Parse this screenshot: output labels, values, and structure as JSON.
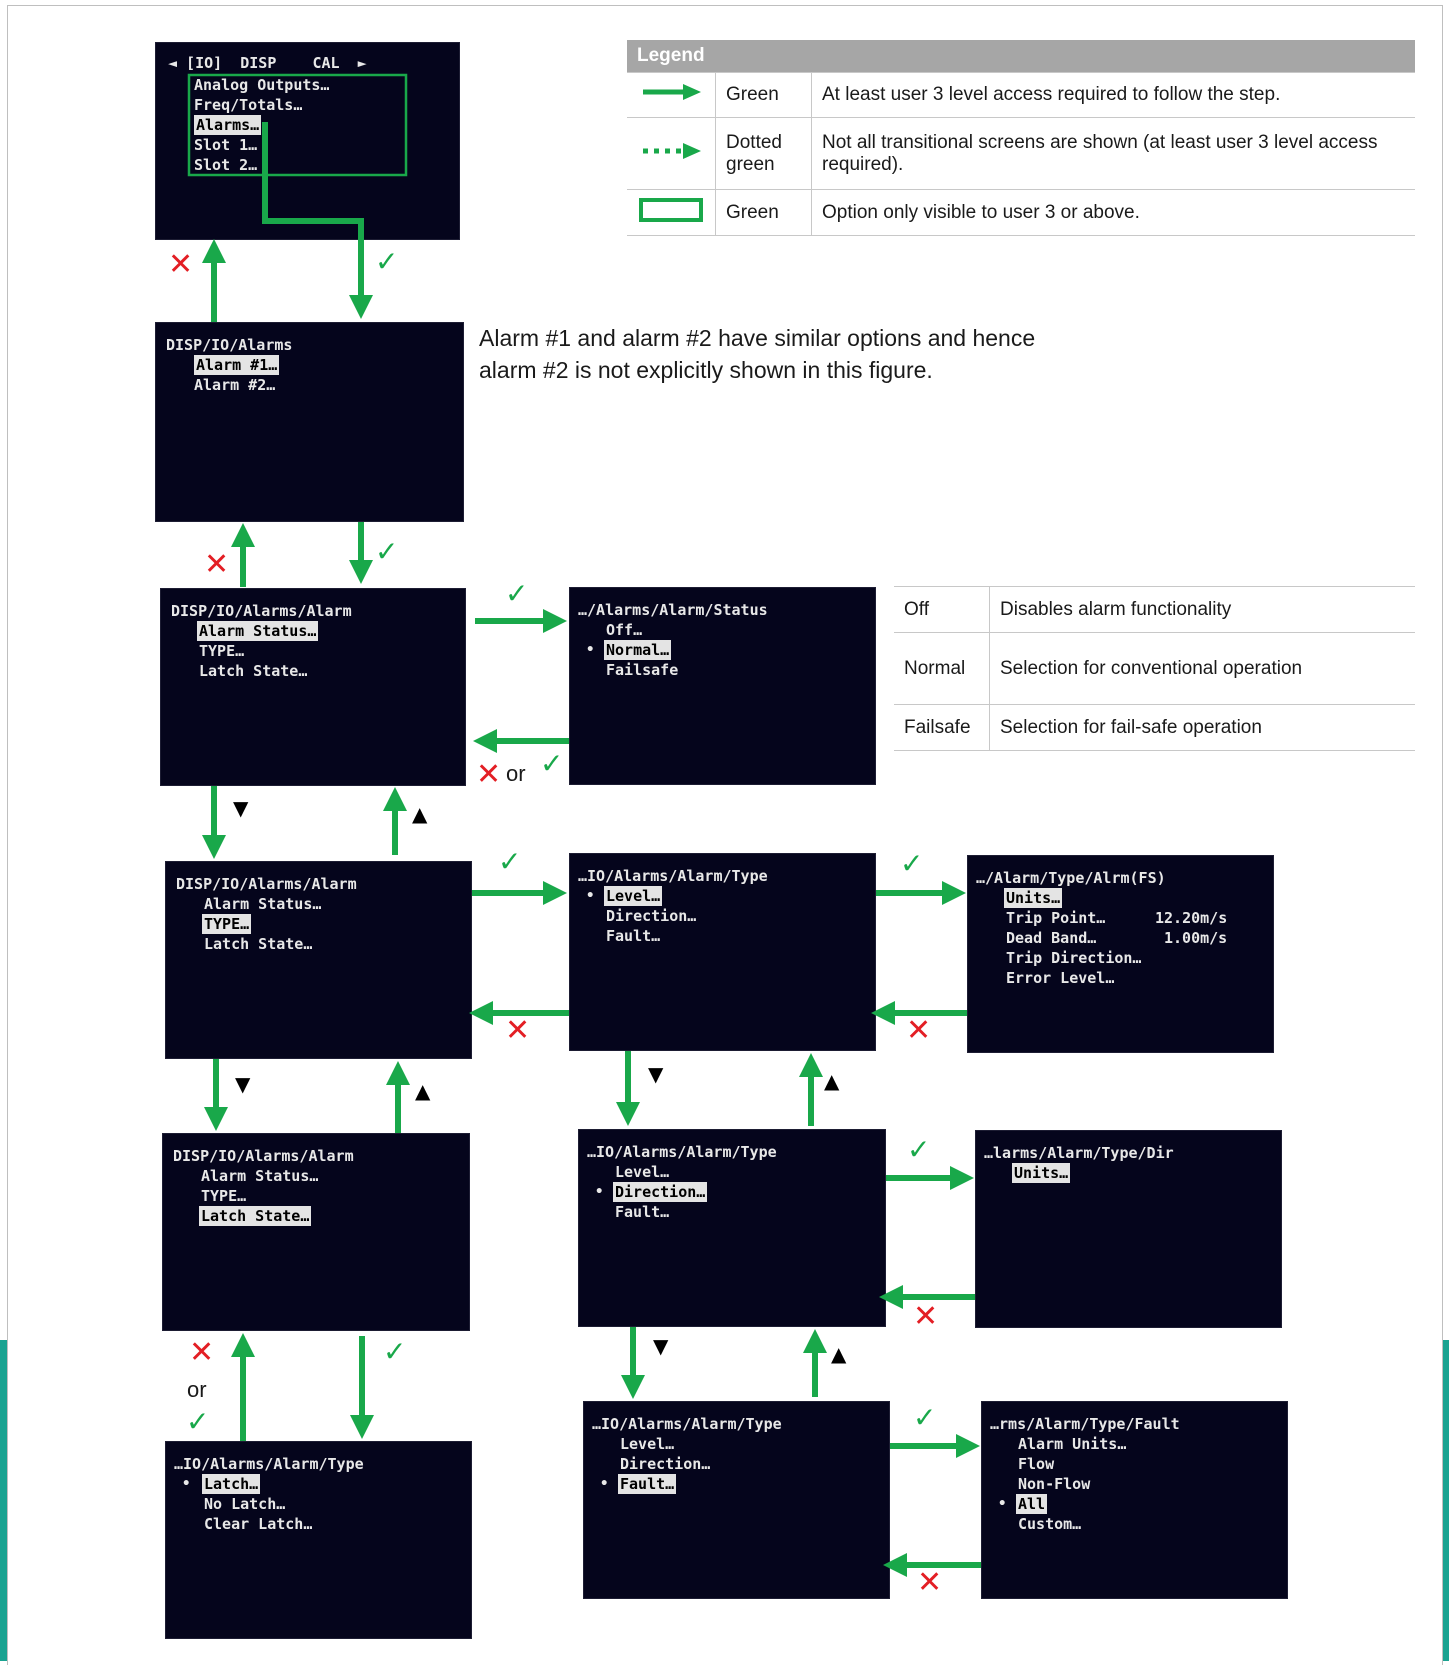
{
  "legend": {
    "title": "Legend",
    "rows": [
      {
        "icon": "solid-green-arrow-icon",
        "name": "Green",
        "desc": "At least user 3 level access required to follow the step."
      },
      {
        "icon": "dotted-green-arrow-icon",
        "name": "Dotted green",
        "desc": "Not all transitional screens are shown (at least user 3 level access required)."
      },
      {
        "icon": "green-box-icon",
        "name": "Green",
        "desc": "Option only visible to user 3 or above."
      }
    ]
  },
  "note": "Alarm #1 and alarm #2 have similar options and hence alarm #2 is not explicitly shown in this figure.",
  "status_table": [
    {
      "option": "Off",
      "desc": "Disables alarm functionality"
    },
    {
      "option": "Normal",
      "desc": "Selection for conventional operation"
    },
    {
      "option": "Failsafe",
      "desc": "Selection for fail-safe operation"
    }
  ],
  "screens": {
    "io_menu": {
      "title": "◄ [IO]  DISP    CAL  ►",
      "lines": [
        "Analog Outputs…",
        "Freq/Totals…",
        "Alarms…",
        "Slot 1…",
        "Slot 2…"
      ]
    },
    "alarms": {
      "title": "DISP/IO/Alarms",
      "lines": [
        "Alarm #1…",
        "Alarm #2…"
      ]
    },
    "alarm_a": {
      "title": "DISP/IO/Alarms/Alarm",
      "lines": [
        "Alarm Status…",
        "TYPE…",
        "Latch State…"
      ]
    },
    "status": {
      "title": "…/Alarms/Alarm/Status",
      "lines": [
        "Off…",
        "Normal…",
        "Failsafe"
      ]
    },
    "alarm_b": {
      "title": "DISP/IO/Alarms/Alarm",
      "lines": [
        "Alarm Status…",
        "TYPE…",
        "Latch State…"
      ]
    },
    "type_a": {
      "title": "…IO/Alarms/Alarm/Type",
      "lines": [
        "Level…",
        "Direction…",
        "Fault…"
      ]
    },
    "alrm_fs": {
      "title": "…/Alarm/Type/Alrm(FS)",
      "lines": [
        "Units…",
        "Trip Point…",
        "Dead Band…",
        "Trip Direction…",
        "Error Level…"
      ],
      "values": [
        "12.20m/s",
        "1.00m/s"
      ]
    },
    "alarm_c": {
      "title": "DISP/IO/Alarms/Alarm",
      "lines": [
        "Alarm Status…",
        "TYPE…",
        "Latch State…"
      ]
    },
    "type_b": {
      "title": "…IO/Alarms/Alarm/Type",
      "lines": [
        "Level…",
        "Direction…",
        "Fault…"
      ]
    },
    "dir": {
      "title": "…larms/Alarm/Type/Dir",
      "lines": [
        "Units…"
      ]
    },
    "latch_type": {
      "title": "…IO/Alarms/Alarm/Type",
      "lines": [
        "Latch…",
        "No Latch…",
        "Clear Latch…"
      ]
    },
    "type_c": {
      "title": "…IO/Alarms/Alarm/Type",
      "lines": [
        "Level…",
        "Direction…",
        "Fault…"
      ]
    },
    "fault": {
      "title": "…rms/Alarm/Type/Fault",
      "lines": [
        "Alarm Units…",
        "Flow",
        "Non-Flow",
        "All",
        "Custom…"
      ]
    }
  },
  "marks": {
    "cross": "✕",
    "check": "✓",
    "or": "or",
    "down": "▼",
    "up": "▲",
    "bullet": "•"
  },
  "colors": {
    "green": "#19a84a",
    "red": "#e31e24",
    "screen_bg": "#05051c",
    "teal": "#1aa391"
  }
}
